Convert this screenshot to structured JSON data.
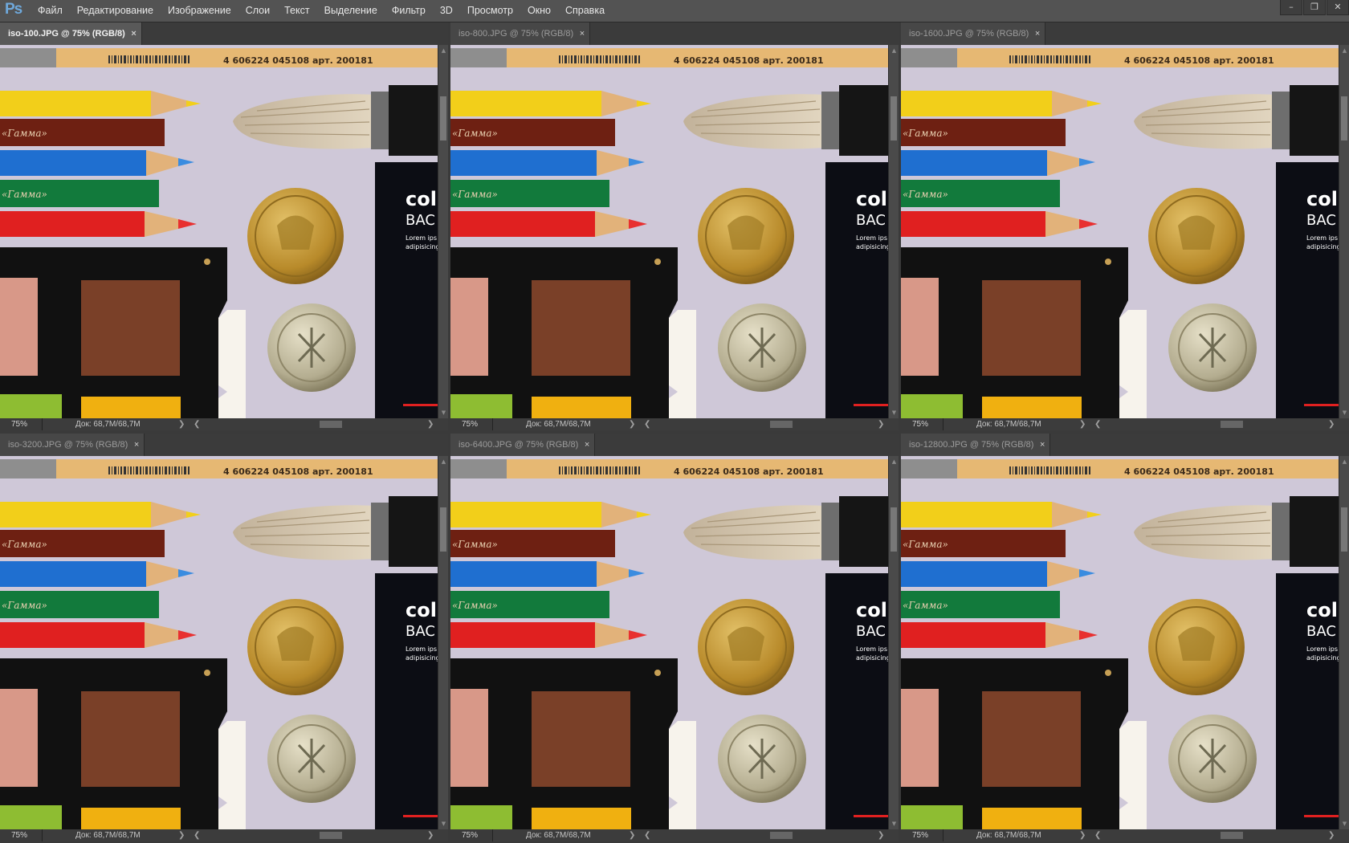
{
  "app": {
    "logo": "Ps",
    "menu": [
      "Файл",
      "Редактирование",
      "Изображение",
      "Слои",
      "Текст",
      "Выделение",
      "Фильтр",
      "3D",
      "Просмотр",
      "Окно",
      "Справка"
    ],
    "window_controls": [
      "–",
      "❐",
      "✕"
    ]
  },
  "documents": [
    {
      "tab": "iso-100.JPG @ 75% (RGB/8)",
      "zoom": "75%",
      "doc_size": "Док: 68,7M/68,7M",
      "close": "×",
      "active": true
    },
    {
      "tab": "iso-800.JPG @ 75% (RGB/8)",
      "zoom": "75%",
      "doc_size": "Док: 68,7M/68,7M",
      "close": "×",
      "active": false
    },
    {
      "tab": "iso-1600.JPG @ 75% (RGB/8)",
      "zoom": "75%",
      "doc_size": "Док: 68,7M/68,7M",
      "close": "×",
      "active": false
    },
    {
      "tab": "iso-3200.JPG @ 75% (RGB/8)",
      "zoom": "75%",
      "doc_size": "Док: 68,7M/68,7M",
      "close": "×",
      "active": false
    },
    {
      "tab": "iso-6400.JPG @ 75% (RGB/8)",
      "zoom": "75%",
      "doc_size": "Док: 68,7M/68,7M",
      "close": "×",
      "active": false
    },
    {
      "tab": "iso-12800.JPG @ 75% (RGB/8)",
      "zoom": "75%",
      "doc_size": "Док: 68,7M/68,7M",
      "close": "×",
      "active": false
    }
  ],
  "photo": {
    "pencil_print": "4 606224 045108 арт. 200181",
    "pencil_brand": "«Гамма»",
    "box_title": "col",
    "box_sub": "BAC",
    "box_text_1": "Lorem ips",
    "box_text_2": "adipisicing"
  },
  "colors": {
    "accent": "#6fa9dc",
    "backdrop": "#cfc8d8",
    "pencil_yellow": "#f2cf1a",
    "pencil_brown": "#6e2012",
    "pencil_blue": "#1f6fd0",
    "pencil_green": "#127a3c",
    "pencil_red": "#e02020",
    "skin_patch": "#d89888",
    "brown_patch": "#7a4028",
    "coin_gold": "#c49a34"
  }
}
